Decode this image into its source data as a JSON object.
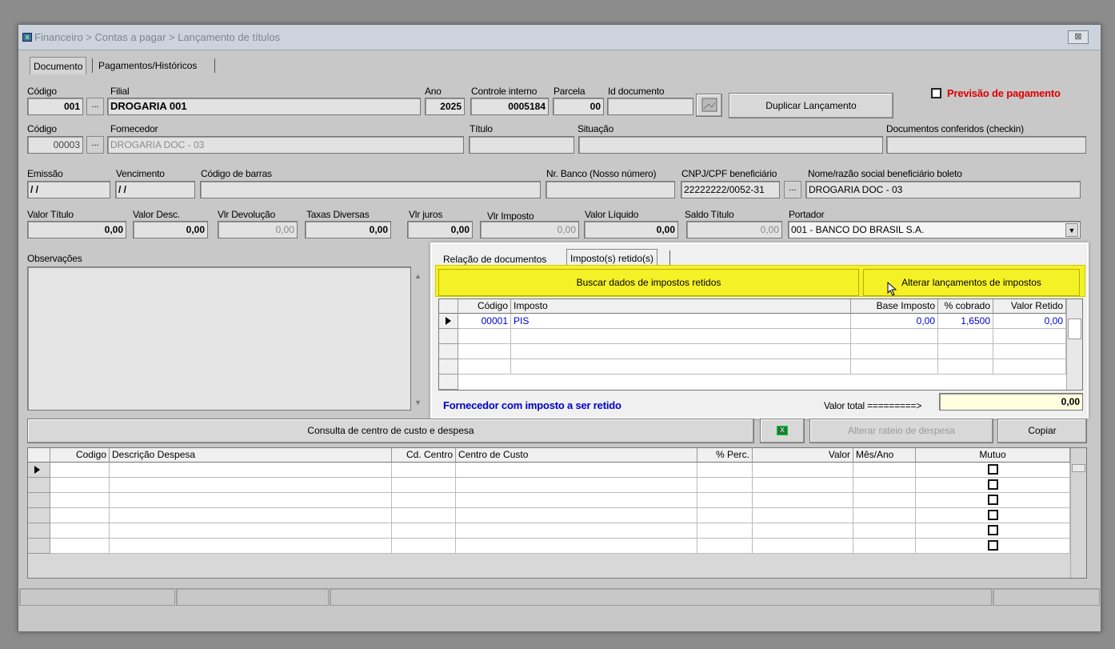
{
  "window": {
    "title": "Financeiro > Contas a pagar > Lançamento de títulos",
    "close": "⊠"
  },
  "main_tabs": [
    "Documento",
    "Pagamentos/Históricos"
  ],
  "labels": {
    "codigo": "Código",
    "filial": "Filial",
    "ano": "Ano",
    "controle": "Controle interno",
    "parcela": "Parcela",
    "id_documento": "Id documento",
    "codigo2": "Código",
    "fornecedor": "Fornecedor",
    "titulo": "Título",
    "situacao": "Situação",
    "doc_conferidos": "Documentos conferidos (checkin)",
    "emissao": "Emissão",
    "vencimento": "Vencimento",
    "codigo_barras": "Código de barras",
    "nr_banco": "Nr. Banco (Nosso número)",
    "cnpj": "CNPJ/CPF beneficiário",
    "nome_benef": "Nome/razão social beneficiário boleto",
    "valor_titulo": "Valor Título",
    "valor_desc": "Valor Desc.",
    "vlr_devolucao": "Vlr Devolução",
    "taxas": "Taxas Diversas",
    "vlr_juros": "Vlr juros",
    "vlr_imposto": "Vlr Imposto",
    "valor_liquido": "Valor Líquido",
    "saldo_titulo": "Saldo Título",
    "portador": "Portador",
    "observacoes": "Observações"
  },
  "values": {
    "codigo": "001",
    "filial": "DROGARIA 001",
    "ano": "2025",
    "controle": "0005184",
    "parcela": "00",
    "fornecedor_codigo": "00003",
    "fornecedor": "DROGARIA DOC - 03",
    "emissao": "/ /",
    "vencimento": "/ /",
    "cnpj": "22222222/0052-31",
    "nome_benef": "DROGARIA DOC - 03",
    "valor_titulo": "0,00",
    "valor_desc": "0,00",
    "vlr_devolucao": "0,00",
    "taxas": "0,00",
    "vlr_juros": "0,00",
    "vlr_imposto": "0,00",
    "valor_liquido": "0,00",
    "saldo_titulo": "0,00",
    "portador": "001 - BANCO DO BRASIL S.A."
  },
  "buttons": {
    "duplicar": "Duplicar Lançamento",
    "dots": "...",
    "previsao": "Previsão de pagamento"
  },
  "tax_panel": {
    "tabs": [
      "Relação de documentos",
      "Imposto(s) retido(s)"
    ],
    "buscar": "Buscar dados de impostos retidos",
    "alterar": "Alterar lançamentos de impostos",
    "columns": [
      "Código",
      "Imposto",
      "Base Imposto",
      "% cobrado",
      "Valor Retido"
    ],
    "rows": [
      {
        "codigo": "00001",
        "imposto": "PIS",
        "base": "0,00",
        "cobrado": "1,6500",
        "retido": "0,00"
      }
    ],
    "note": "Fornecedor com imposto a ser retido",
    "total_label": "Valor total =========>",
    "total_value": "0,00"
  },
  "cost_center": {
    "consulta": "Consulta de centro de custo e despesa",
    "alterar_rateio": "Alterar rateio de despesa",
    "copiar": "Copiar",
    "columns": [
      "Codigo",
      "Descrição Despesa",
      "Cd. Centro",
      "Centro de Custo",
      "% Perc.",
      "Valor",
      "Mês/Ano",
      "Mutuo"
    ]
  }
}
